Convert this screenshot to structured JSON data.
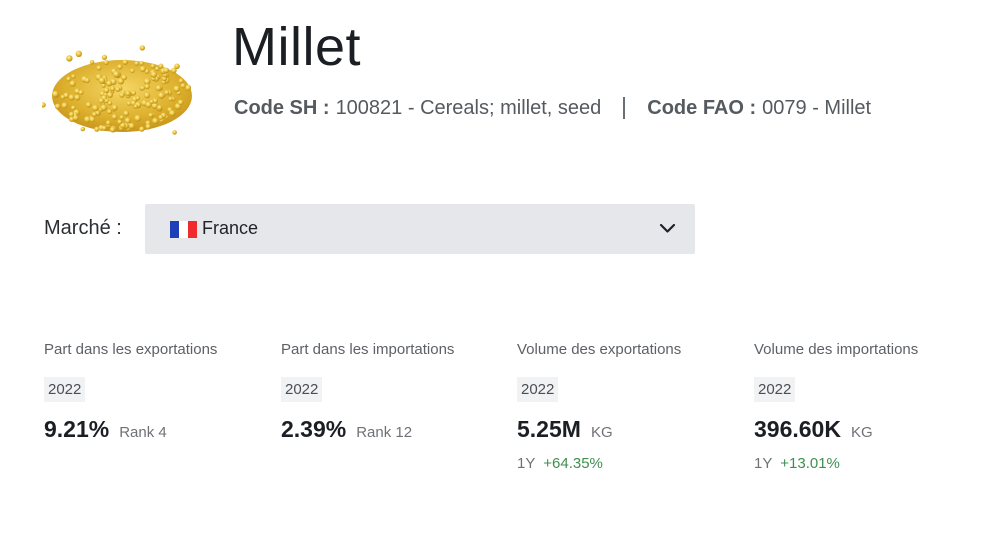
{
  "product": {
    "title": "Millet",
    "image_icon": "millet-seeds-image",
    "code_sh_label": "Code SH :",
    "code_sh_value": "100821 - Cereals; millet, seed",
    "code_fao_label": "Code FAO :",
    "code_fao_value": "0079 - Millet"
  },
  "market": {
    "label": "Marché :",
    "selected": "France",
    "flag_icon": "france-flag-icon",
    "flag_colors": [
      "#1f3fb8",
      "#ffffff",
      "#ef2b2d"
    ],
    "dropdown_icon": "chevron-down-icon"
  },
  "stats": [
    {
      "title": "Part dans les exportations",
      "year": "2022",
      "value": "9.21%",
      "sub": "Rank 4"
    },
    {
      "title": "Part dans les importations",
      "year": "2022",
      "value": "2.39%",
      "sub": "Rank 12"
    },
    {
      "title": "Volume des exportations",
      "year": "2022",
      "value": "5.25M",
      "sub": "KG",
      "change_period": "1Y",
      "change_value": "+64.35%"
    },
    {
      "title": "Volume des importations",
      "year": "2022",
      "value": "396.60K",
      "sub": "KG",
      "change_period": "1Y",
      "change_value": "+13.01%"
    }
  ],
  "colors": {
    "positive_change": "#3f8f4f",
    "select_background": "#e6e7eb",
    "millet_seed": "#e8c13a"
  }
}
